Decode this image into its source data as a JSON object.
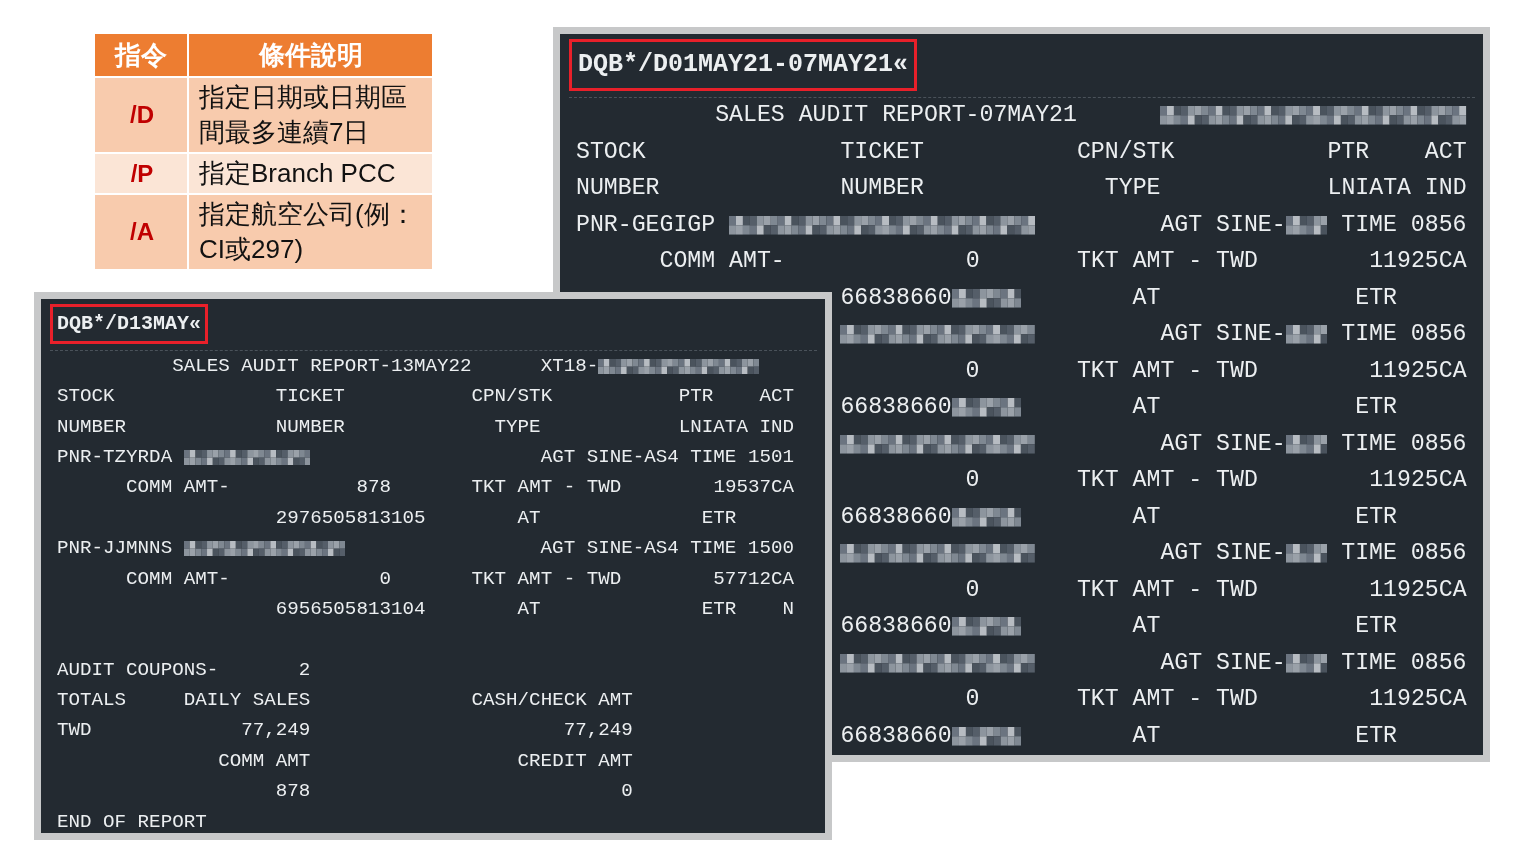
{
  "table": {
    "columns": [
      "指令",
      "條件說明"
    ],
    "rows": [
      {
        "command": "/D",
        "description": "指定日期或日期區間最多連續7日"
      },
      {
        "command": "/P",
        "description": "指定Branch PCC"
      },
      {
        "command": "/A",
        "description": "指定航空公司(例：CI或297)"
      }
    ]
  },
  "back_terminal": {
    "command": "DQB*/D01MAY21-07MAY21«",
    "lines": [
      {
        "parts": [
          {
            "kind": "text",
            "text": "          SALES AUDIT REPORT-07MAY21      "
          },
          {
            "kind": "blur_xl"
          }
        ]
      },
      {
        "parts": [
          {
            "kind": "text",
            "text": "STOCK              TICKET           CPN/STK           PTR    ACT"
          }
        ]
      },
      {
        "parts": [
          {
            "kind": "text",
            "text": "NUMBER             NUMBER             TYPE            LNIATA IND"
          }
        ]
      },
      {
        "parts": [
          {
            "kind": "text",
            "text": "PNR-GEGIGP "
          },
          {
            "kind": "blur_xl"
          },
          {
            "kind": "text",
            "text": "         AGT SINE-"
          },
          {
            "kind": "blur_xs"
          },
          {
            "kind": "text",
            "text": " TIME 0856"
          }
        ]
      },
      {
        "parts": [
          {
            "kind": "text",
            "text": "      COMM AMT-             0       TKT AMT - TWD        11925CA"
          }
        ]
      },
      {
        "covered": true,
        "parts": [
          {
            "kind": "text",
            "text": "66838660"
          },
          {
            "kind": "blur_s"
          },
          {
            "kind": "text",
            "text": "        AT              ETR"
          }
        ]
      },
      {
        "covered": true,
        "parts": [
          {
            "kind": "blur_l"
          },
          {
            "kind": "text",
            "text": "         AGT SINE-"
          },
          {
            "kind": "blur_xs"
          },
          {
            "kind": "text",
            "text": " TIME 0856"
          }
        ]
      },
      {
        "covered": true,
        "parts": [
          {
            "kind": "text",
            "text": "         0       TKT AMT - TWD        11925CA"
          }
        ]
      },
      {
        "covered": true,
        "parts": [
          {
            "kind": "text",
            "text": "66838660"
          },
          {
            "kind": "blur_s"
          },
          {
            "kind": "text",
            "text": "        AT              ETR"
          }
        ]
      },
      {
        "covered": true,
        "parts": [
          {
            "kind": "blur_l"
          },
          {
            "kind": "text",
            "text": "         AGT SINE-"
          },
          {
            "kind": "blur_xs"
          },
          {
            "kind": "text",
            "text": " TIME 0856"
          }
        ]
      },
      {
        "covered": true,
        "parts": [
          {
            "kind": "text",
            "text": "         0       TKT AMT - TWD        11925CA"
          }
        ]
      },
      {
        "covered": true,
        "parts": [
          {
            "kind": "text",
            "text": "66838660"
          },
          {
            "kind": "blur_s"
          },
          {
            "kind": "text",
            "text": "        AT              ETR"
          }
        ]
      },
      {
        "covered": true,
        "parts": [
          {
            "kind": "blur_l"
          },
          {
            "kind": "text",
            "text": "         AGT SINE-"
          },
          {
            "kind": "blur_xs"
          },
          {
            "kind": "text",
            "text": " TIME 0856"
          }
        ]
      },
      {
        "covered": true,
        "parts": [
          {
            "kind": "text",
            "text": "         0       TKT AMT - TWD        11925CA"
          }
        ]
      },
      {
        "covered": true,
        "parts": [
          {
            "kind": "text",
            "text": "66838660"
          },
          {
            "kind": "blur_s"
          },
          {
            "kind": "text",
            "text": "        AT              ETR"
          }
        ]
      },
      {
        "covered": true,
        "parts": [
          {
            "kind": "blur_l"
          },
          {
            "kind": "text",
            "text": "         AGT SINE-"
          },
          {
            "kind": "blur_xs"
          },
          {
            "kind": "text",
            "text": " TIME 0856"
          }
        ]
      },
      {
        "covered": true,
        "parts": [
          {
            "kind": "text",
            "text": "         0       TKT AMT - TWD        11925CA"
          }
        ]
      },
      {
        "covered": true,
        "parts": [
          {
            "kind": "text",
            "text": "66838660"
          },
          {
            "kind": "blur_s"
          },
          {
            "kind": "text",
            "text": "        AT              ETR"
          }
        ]
      }
    ]
  },
  "front_terminal": {
    "command": "DQB*/D13MAY«",
    "lines": [
      {
        "parts": [
          {
            "kind": "text",
            "text": "          SALES AUDIT REPORT-13MAY22      XT18-"
          },
          {
            "kind": "blur_l"
          }
        ]
      },
      {
        "parts": [
          {
            "kind": "text",
            "text": "STOCK              TICKET           CPN/STK           PTR    ACT"
          }
        ]
      },
      {
        "parts": [
          {
            "kind": "text",
            "text": "NUMBER             NUMBER             TYPE            LNIATA IND"
          }
        ]
      },
      {
        "parts": [
          {
            "kind": "text",
            "text": "PNR-TZYRDA "
          },
          {
            "kind": "blur_m"
          },
          {
            "kind": "text",
            "text": "                    AGT SINE-AS4 TIME 1501"
          }
        ]
      },
      {
        "parts": [
          {
            "kind": "text",
            "text": "      COMM AMT-           878       TKT AMT - TWD        19537CA"
          }
        ]
      },
      {
        "parts": [
          {
            "kind": "text",
            "text": "                   2976505813105        AT              ETR"
          }
        ]
      },
      {
        "parts": [
          {
            "kind": "text",
            "text": "PNR-JJMNNS "
          },
          {
            "kind": "blur_l"
          },
          {
            "kind": "text",
            "text": "                 AGT SINE-AS4 TIME 1500"
          }
        ]
      },
      {
        "parts": [
          {
            "kind": "text",
            "text": "      COMM AMT-             0       TKT AMT - TWD        57712CA"
          }
        ]
      },
      {
        "parts": [
          {
            "kind": "text",
            "text": "                   6956505813104        AT              ETR    N"
          }
        ]
      },
      {
        "gap_before": true,
        "parts": [
          {
            "kind": "text",
            "text": "AUDIT COUPONS-       2"
          }
        ]
      },
      {
        "parts": [
          {
            "kind": "text",
            "text": "TOTALS     DAILY SALES              CASH/CHECK AMT"
          }
        ]
      },
      {
        "parts": [
          {
            "kind": "text",
            "text": "TWD             77,249                      77,249"
          }
        ]
      },
      {
        "parts": [
          {
            "kind": "text",
            "text": "              COMM AMT                  CREDIT AMT"
          }
        ]
      },
      {
        "parts": [
          {
            "kind": "text",
            "text": "                   878                           0"
          }
        ]
      },
      {
        "parts": [
          {
            "kind": "text",
            "text": "END OF REPORT"
          }
        ]
      }
    ]
  }
}
